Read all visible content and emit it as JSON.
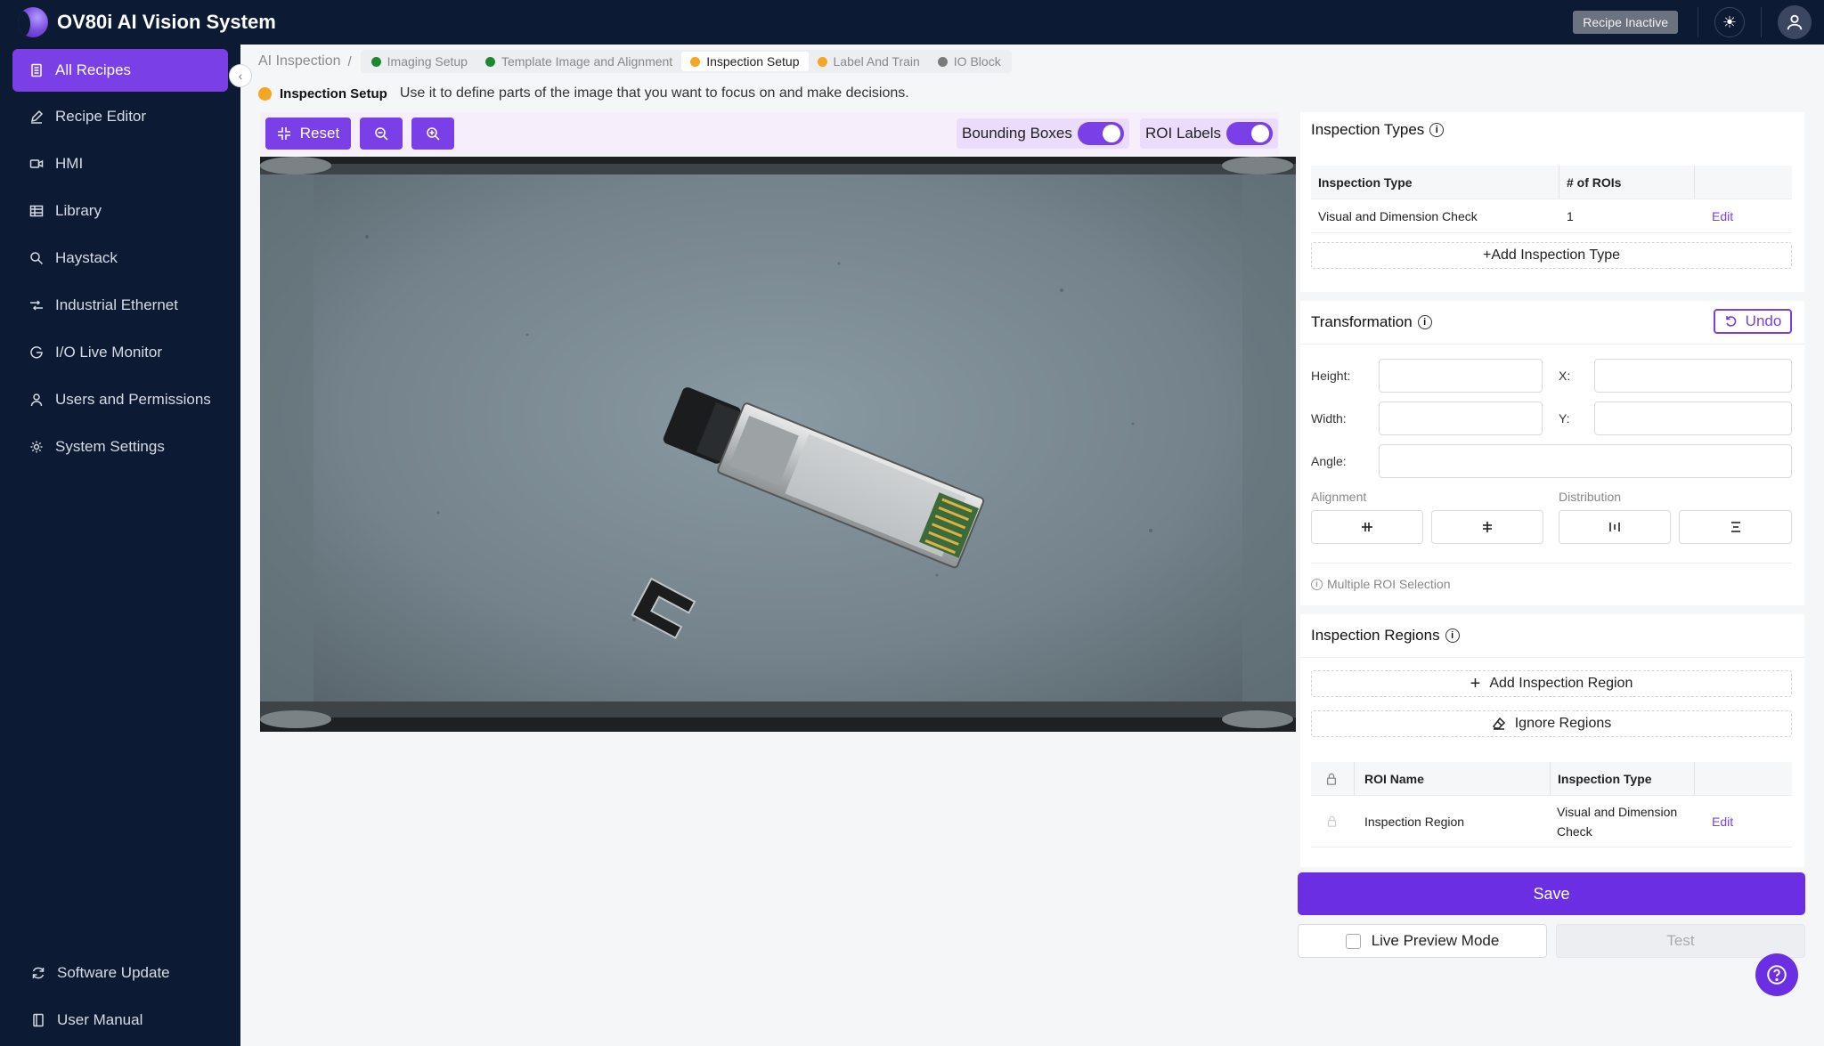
{
  "app": {
    "title": "OV80i AI Vision System",
    "recipe_status": "Recipe Inactive"
  },
  "sidebar": {
    "items": [
      {
        "label": "All Recipes",
        "icon": "document-icon"
      },
      {
        "label": "Recipe Editor",
        "icon": "pencil-icon"
      },
      {
        "label": "HMI",
        "icon": "video-icon"
      },
      {
        "label": "Library",
        "icon": "grid-icon"
      },
      {
        "label": "Haystack",
        "icon": "search-icon"
      },
      {
        "label": "Industrial Ethernet",
        "icon": "network-icon"
      },
      {
        "label": "I/O Live Monitor",
        "icon": "monitor-icon"
      },
      {
        "label": "Users and Permissions",
        "icon": "user-icon"
      },
      {
        "label": "System Settings",
        "icon": "gear-icon"
      }
    ],
    "bottom": [
      {
        "label": "Software Update",
        "icon": "refresh-icon"
      },
      {
        "label": "User Manual",
        "icon": "book-icon"
      }
    ]
  },
  "breadcrumb": {
    "root": "AI Inspection",
    "separator": "/",
    "tabs": [
      {
        "label": "Imaging Setup",
        "status_color": "#1a8a2e"
      },
      {
        "label": "Template Image and Alignment",
        "status_color": "#1a8a2e"
      },
      {
        "label": "Inspection Setup",
        "status_color": "#f5a623"
      },
      {
        "label": "Label And Train",
        "status_color": "#f5a623"
      },
      {
        "label": "IO Block",
        "status_color": "#7a7a7a"
      }
    ]
  },
  "subheader": {
    "step": "Inspection Setup",
    "description": "Use it to define parts of the image that you want to focus on and make decisions."
  },
  "toolbar": {
    "reset_label": "Reset",
    "bounding_boxes_label": "Bounding Boxes",
    "roi_labels_label": "ROI Labels"
  },
  "inspection_types": {
    "title": "Inspection Types",
    "headers": {
      "type": "Inspection Type",
      "count": "# of ROIs"
    },
    "rows": [
      {
        "type": "Visual and Dimension Check",
        "count": "1",
        "action": "Edit"
      }
    ],
    "add_label": "+Add Inspection Type"
  },
  "transformation": {
    "title": "Transformation",
    "undo_label": "Undo",
    "height_label": "Height:",
    "width_label": "Width:",
    "angle_label": "Angle:",
    "x_label": "X:",
    "y_label": "Y:",
    "alignment_label": "Alignment",
    "distribution_label": "Distribution",
    "multi_note": "Multiple ROI Selection"
  },
  "inspection_regions": {
    "title": "Inspection Regions",
    "add_label": "Add Inspection Region",
    "ignore_label": "Ignore Regions",
    "headers": {
      "name": "ROI Name",
      "type": "Inspection Type"
    },
    "rows": [
      {
        "name": "Inspection Region",
        "type": "Visual and Dimension Check",
        "action": "Edit"
      }
    ]
  },
  "actions": {
    "save_label": "Save",
    "live_preview_label": "Live Preview Mode",
    "test_label": "Test"
  },
  "colors": {
    "accent": "#7a3fe6",
    "nav_bg": "#0c1a33"
  }
}
